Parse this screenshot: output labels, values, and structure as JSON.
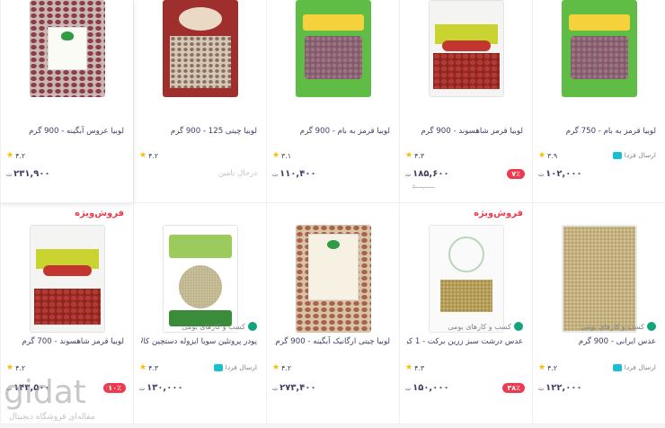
{
  "currency": "تومان",
  "special_label": "فروش‌ویژه",
  "out_of_stock": "درحال تامین",
  "fast_label": "ارسال فردا",
  "products_row1": [
    {
      "title": "لوبیا قرمز به بام - 750 گرم",
      "rating": "۳.۹",
      "price": "۱۰۲,۰۰۰",
      "fast": true,
      "art": "green"
    },
    {
      "title": "لوبیا قرمز شاهسوند - 900 گرم",
      "rating": "۴.۳",
      "price": "۱۸۵,۶۰۰",
      "old_price": "۲۰۰,۰۰۰",
      "discount": "۷٪",
      "art": "white"
    },
    {
      "title": "لوبیا قرمز به بام - 900 گرم",
      "rating": "۳.۱",
      "price": "۱۱۰,۴۰۰",
      "art": "green"
    },
    {
      "title": "لوبیا چیتی 125 - 900 گرم",
      "rating": "۴.۲",
      "stock": true,
      "art": "red"
    },
    {
      "title": "لوبیا عروس آبگینه - 900 گرم",
      "rating": "۴.۲",
      "price": "۲۳۱,۹۰۰",
      "art": "clear"
    }
  ],
  "products_row2": [
    {
      "title": "عدس ایرانی - 900 گرم",
      "rating": "۴.۲",
      "price": "۱۲۲,۰۰۰",
      "special": false,
      "seller": "کسب و کارهای بومی",
      "fast": true,
      "art": "lentil"
    },
    {
      "title": "عدس درشت سبز زرین برکت - 1 کیلو گرم",
      "rating": "۴.۳",
      "price": "۱۵۰,۰۰۰",
      "discount": "۳۸٪",
      "special": true,
      "seller": "کسب و کارهای بومی",
      "art": "white2"
    },
    {
      "title": "لوبیا چیتی ارگانیک آبگینه - 900 گرم",
      "rating": "۴.۲",
      "price": "۲۷۳,۴۰۰",
      "special": false,
      "art": "bean2"
    },
    {
      "title": "پودر پروتئین سویا ایزوله دستچین کالا - 100 گرم",
      "rating": "۴.۳",
      "price": "۱۳۰,۰۰۰",
      "special": false,
      "seller": "کسب و کارهای بومی",
      "fast": true,
      "art": "soy"
    },
    {
      "title": "لوبیا قرمز شاهسوند - 700 گرم",
      "rating": "۴.۲",
      "price": "۱۴۳,۵۰۰",
      "discount": "۱۰٪",
      "special": true,
      "art": "white"
    }
  ],
  "watermark": {
    "brand": "gidat",
    "tld": ".ir",
    "sub": "مقاله‌ای فروشگاه دیجیتال"
  }
}
